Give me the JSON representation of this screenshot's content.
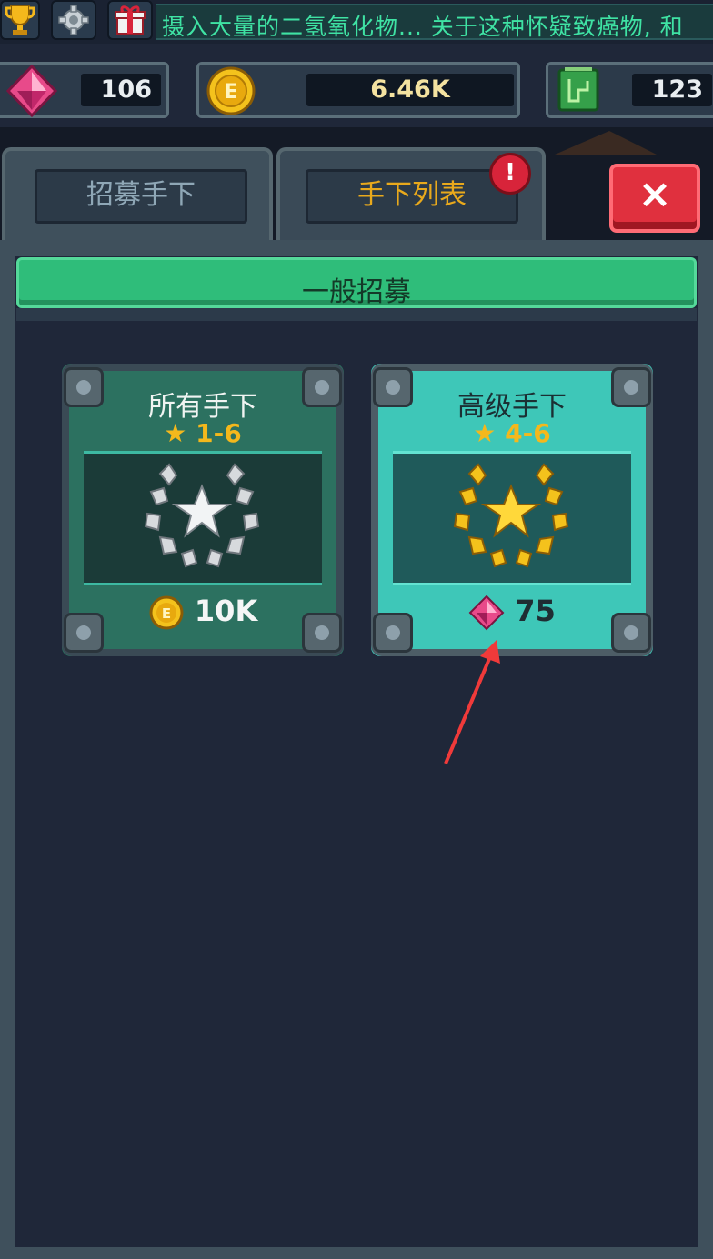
{
  "ticker_text": "摄入大量的二氢氧化物... 关于这种怀疑致癌物, 和",
  "resources": {
    "gems": "106",
    "coins": "6.46K",
    "chips": "123"
  },
  "tabs": {
    "recruit": "招募手下",
    "minion_list": "手下列表",
    "alert_mark": "!",
    "close_label": "×"
  },
  "section_title": "一般招募",
  "cards": [
    {
      "title": "所有手下",
      "stars": "1-6",
      "price": "10K",
      "currency_icon": "coin-icon",
      "emblem": "silver-laurel-icon"
    },
    {
      "title": "高级手下",
      "stars": "4-6",
      "price": "75",
      "currency_icon": "gem-icon",
      "emblem": "gold-laurel-icon"
    }
  ],
  "colors": {
    "accent_green": "#2fbd7a",
    "card_basic": "#2c7160",
    "card_premium": "#3ec7b8",
    "close_red": "#e0303e",
    "gold": "#f4b81c",
    "ticker_text": "#3fe3a4"
  }
}
